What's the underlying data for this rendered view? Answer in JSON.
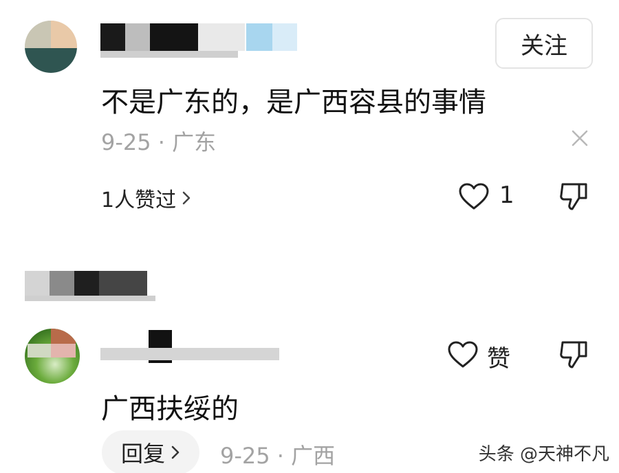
{
  "comment1": {
    "follow_label": "关注",
    "text": "不是广东的，是广西容县的事情",
    "meta": "9-25 · 广东",
    "likes_link": "1人赞过",
    "like_count": "1"
  },
  "comment2": {
    "text": "广西扶绥的",
    "like_label": "赞",
    "reply_label": "回复",
    "meta": "9-25 · 广西"
  },
  "watermark": "头条 @天神不凡",
  "icons": [
    "heart-icon",
    "thumb-down-icon",
    "close-icon",
    "chevron-right-icon"
  ]
}
